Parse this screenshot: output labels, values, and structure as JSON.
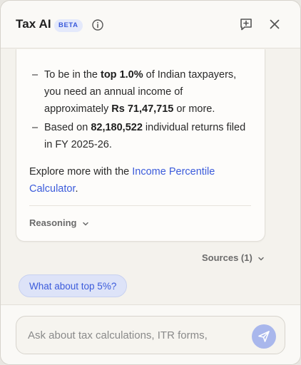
{
  "header": {
    "title": "Tax AI",
    "badge": "BETA"
  },
  "answer": {
    "bullets": [
      {
        "dash": "–",
        "pre": "To be in the ",
        "bold1": "top 1.0%",
        "mid": " of Indian taxpayers, you need an annual income of approximately ",
        "bold2": "Rs 71,47,715",
        "post": " or more."
      },
      {
        "dash": "–",
        "pre": "Based on ",
        "bold1": "82,180,522",
        "mid": " individual returns filed in FY 2025-26."
      }
    ],
    "explore_pre": "Explore more with the ",
    "explore_link": "Income Percentile Calculator",
    "explore_post": ".",
    "reasoning_label": "Reasoning"
  },
  "sources_label": "Sources (1)",
  "suggestion": "What about top 5%?",
  "composer": {
    "placeholder": "Ask about tax calculations, ITR forms,"
  },
  "colors": {
    "accent": "#3b5bdb",
    "send_button": "#a9b7ec",
    "chip_bg": "#dde3f8"
  },
  "icons": {
    "info": "info-icon",
    "new_chat": "new-chat-icon",
    "close": "close-icon",
    "chevron": "chevron-down-icon",
    "send": "send-icon"
  }
}
